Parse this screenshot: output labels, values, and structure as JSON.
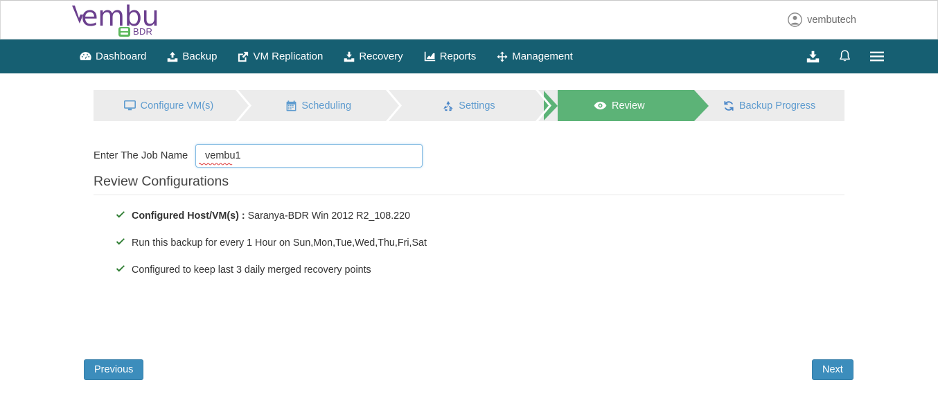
{
  "header": {
    "logo_text": "embu",
    "logo_badge_label": "BDR",
    "logo_badge_icon": "server-icon",
    "user": {
      "name": "vembutech",
      "icon": "user-circle-icon"
    }
  },
  "navbar": {
    "background_color": "#165f72",
    "items": [
      {
        "label": "Dashboard",
        "icon": "dashboard-icon"
      },
      {
        "label": "Backup",
        "icon": "upload-icon"
      },
      {
        "label": "VM Replication",
        "icon": "external-link-icon"
      },
      {
        "label": "Recovery",
        "icon": "download-icon"
      },
      {
        "label": "Reports",
        "icon": "chart-line-icon"
      },
      {
        "label": "Management",
        "icon": "compress-arrows-icon"
      }
    ],
    "right_icons": [
      {
        "name": "download-icon"
      },
      {
        "name": "bell-icon"
      },
      {
        "name": "hamburger-menu-icon"
      }
    ]
  },
  "wizard": {
    "active_color": "#5cb377",
    "inactive_color": "#5f9ccf",
    "background_color": "#ececec",
    "steps": [
      {
        "label": "Configure VM(s)",
        "icon": "desktop-icon",
        "active": false
      },
      {
        "label": "Scheduling",
        "icon": "calendar-icon",
        "active": false
      },
      {
        "label": "Settings",
        "icon": "recycle-icon",
        "active": false
      },
      {
        "label": "Review",
        "icon": "eye-icon",
        "active": true
      },
      {
        "label": "Backup Progress",
        "icon": "refresh-icon",
        "active": false
      }
    ]
  },
  "form": {
    "job_name_label": "Enter The Job Name",
    "job_name_value": "vembu1",
    "job_name_placeholder": "Enter The Job Name"
  },
  "review": {
    "title": "Review Configurations",
    "items": [
      {
        "bold_prefix": "Configured Host/VM(s) : ",
        "text": "Saranya-BDR Win 2012 R2_108.220",
        "icon": "check-icon"
      },
      {
        "bold_prefix": "",
        "text": "Run this backup for every 1 Hour on Sun,Mon,Tue,Wed,Thu,Fri,Sat",
        "icon": "check-icon"
      },
      {
        "bold_prefix": "",
        "text": "Configured to keep last 3 daily merged recovery points",
        "icon": "check-icon"
      }
    ]
  },
  "footer": {
    "previous_label": "Previous",
    "next_label": "Next",
    "button_color": "#3c8dbc"
  }
}
